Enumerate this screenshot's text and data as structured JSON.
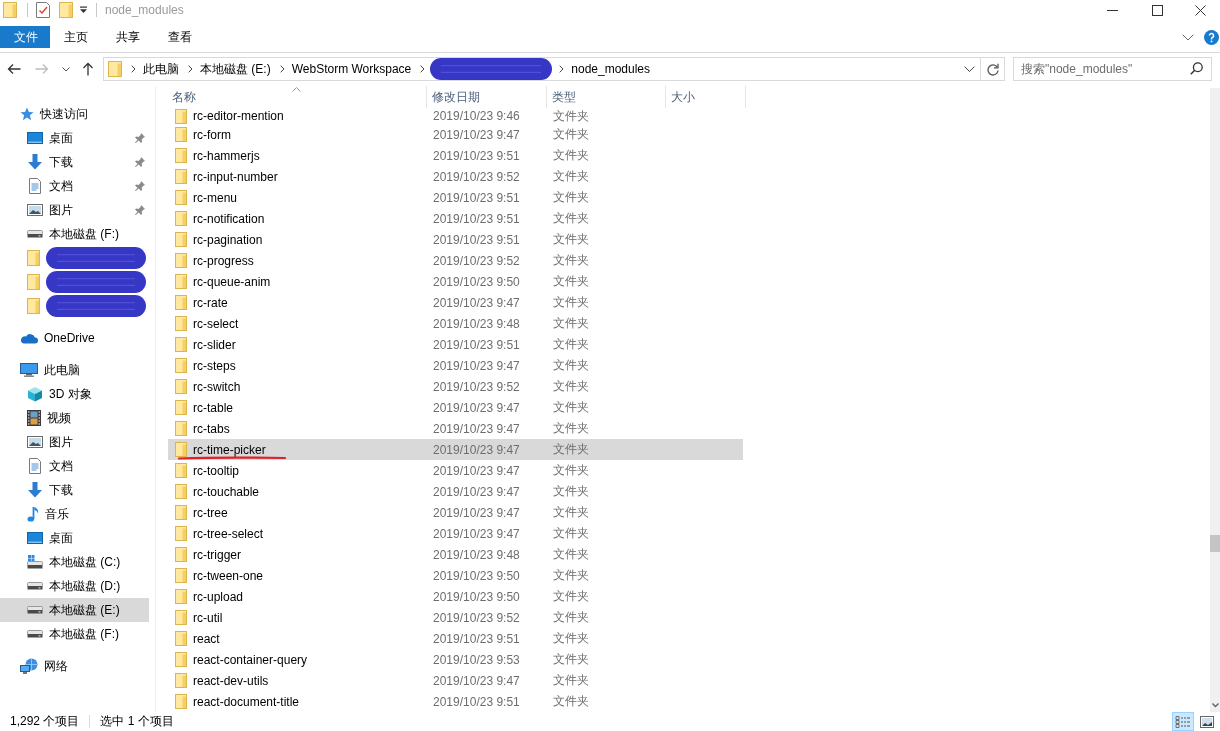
{
  "window": {
    "title": "node_modules"
  },
  "ribbon": {
    "tabs": [
      {
        "label": "文件",
        "kind": "file"
      },
      {
        "label": "主页",
        "kind": "tab"
      },
      {
        "label": "共享",
        "kind": "tab"
      },
      {
        "label": "查看",
        "kind": "tab"
      }
    ]
  },
  "navigation": {
    "back_disabled": false,
    "forward_disabled": true
  },
  "address_bar": {
    "crumbs": [
      {
        "kind": "text",
        "label": "此电脑"
      },
      {
        "kind": "text",
        "label": "本地磁盘 (E:)"
      },
      {
        "kind": "text",
        "label": "WebStorm Workspace"
      },
      {
        "kind": "redacted"
      },
      {
        "kind": "text",
        "label": "node_modules"
      }
    ]
  },
  "search": {
    "placeholder": "搜索\"node_modules\""
  },
  "sidebar": {
    "items": [
      {
        "kind": "quickaccess",
        "label": "快速访问",
        "selected": false,
        "children": [
          {
            "kind": "desktop",
            "label": "桌面",
            "selected": false,
            "pinned": true
          },
          {
            "kind": "downloads",
            "label": "下载",
            "selected": false,
            "pinned": true
          },
          {
            "kind": "documents",
            "label": "文档",
            "selected": false,
            "pinned": true
          },
          {
            "kind": "pictures",
            "label": "图片",
            "selected": false,
            "pinned": true
          },
          {
            "kind": "drive",
            "label": "本地磁盘 (F:)",
            "selected": false,
            "pinned": false
          },
          {
            "kind": "redacted",
            "selected": false,
            "pinned": false
          },
          {
            "kind": "redacted",
            "selected": false,
            "pinned": false
          },
          {
            "kind": "redacted",
            "selected": false,
            "pinned": false
          }
        ]
      },
      {
        "kind": "onedrive",
        "label": "OneDrive",
        "selected": false
      },
      {
        "kind": "computer",
        "label": "此电脑",
        "selected": false,
        "children": [
          {
            "kind": "objects",
            "label": "3D 对象",
            "selected": false
          },
          {
            "kind": "videos",
            "label": "视频",
            "selected": false
          },
          {
            "kind": "pictures",
            "label": "图片",
            "selected": false
          },
          {
            "kind": "documents",
            "label": "文档",
            "selected": false
          },
          {
            "kind": "downloads",
            "label": "下载",
            "selected": false
          },
          {
            "kind": "music",
            "label": "音乐",
            "selected": false
          },
          {
            "kind": "desktop",
            "label": "桌面",
            "selected": false
          },
          {
            "kind": "systemdrive",
            "label": "本地磁盘 (C:)",
            "selected": false
          },
          {
            "kind": "drive",
            "label": "本地磁盘 (D:)",
            "selected": false
          },
          {
            "kind": "drive",
            "label": "本地磁盘 (E:)",
            "selected": true
          },
          {
            "kind": "drive",
            "label": "本地磁盘 (F:)",
            "selected": false
          }
        ]
      },
      {
        "kind": "network",
        "label": "网络",
        "selected": false
      }
    ]
  },
  "file_list": {
    "columns": [
      {
        "label": "名称",
        "sorted": true
      },
      {
        "label": "修改日期",
        "sorted": false
      },
      {
        "label": "类型",
        "sorted": false
      },
      {
        "label": "大小",
        "sorted": false
      }
    ],
    "rows": [
      {
        "name": "rc-editor-mention",
        "modified": "2019/10/23 9:46",
        "type": "文件夹",
        "selected": false,
        "underlined": false
      },
      {
        "name": "rc-form",
        "modified": "2019/10/23 9:47",
        "type": "文件夹",
        "selected": false,
        "underlined": false
      },
      {
        "name": "rc-hammerjs",
        "modified": "2019/10/23 9:51",
        "type": "文件夹",
        "selected": false,
        "underlined": false
      },
      {
        "name": "rc-input-number",
        "modified": "2019/10/23 9:52",
        "type": "文件夹",
        "selected": false,
        "underlined": false
      },
      {
        "name": "rc-menu",
        "modified": "2019/10/23 9:51",
        "type": "文件夹",
        "selected": false,
        "underlined": false
      },
      {
        "name": "rc-notification",
        "modified": "2019/10/23 9:51",
        "type": "文件夹",
        "selected": false,
        "underlined": false
      },
      {
        "name": "rc-pagination",
        "modified": "2019/10/23 9:51",
        "type": "文件夹",
        "selected": false,
        "underlined": false
      },
      {
        "name": "rc-progress",
        "modified": "2019/10/23 9:52",
        "type": "文件夹",
        "selected": false,
        "underlined": false
      },
      {
        "name": "rc-queue-anim",
        "modified": "2019/10/23 9:50",
        "type": "文件夹",
        "selected": false,
        "underlined": false
      },
      {
        "name": "rc-rate",
        "modified": "2019/10/23 9:47",
        "type": "文件夹",
        "selected": false,
        "underlined": false
      },
      {
        "name": "rc-select",
        "modified": "2019/10/23 9:48",
        "type": "文件夹",
        "selected": false,
        "underlined": false
      },
      {
        "name": "rc-slider",
        "modified": "2019/10/23 9:51",
        "type": "文件夹",
        "selected": false,
        "underlined": false
      },
      {
        "name": "rc-steps",
        "modified": "2019/10/23 9:47",
        "type": "文件夹",
        "selected": false,
        "underlined": false
      },
      {
        "name": "rc-switch",
        "modified": "2019/10/23 9:52",
        "type": "文件夹",
        "selected": false,
        "underlined": false
      },
      {
        "name": "rc-table",
        "modified": "2019/10/23 9:47",
        "type": "文件夹",
        "selected": false,
        "underlined": false
      },
      {
        "name": "rc-tabs",
        "modified": "2019/10/23 9:47",
        "type": "文件夹",
        "selected": false,
        "underlined": false
      },
      {
        "name": "rc-time-picker",
        "modified": "2019/10/23 9:47",
        "type": "文件夹",
        "selected": true,
        "underlined": true
      },
      {
        "name": "rc-tooltip",
        "modified": "2019/10/23 9:47",
        "type": "文件夹",
        "selected": false,
        "underlined": false
      },
      {
        "name": "rc-touchable",
        "modified": "2019/10/23 9:47",
        "type": "文件夹",
        "selected": false,
        "underlined": false
      },
      {
        "name": "rc-tree",
        "modified": "2019/10/23 9:47",
        "type": "文件夹",
        "selected": false,
        "underlined": false
      },
      {
        "name": "rc-tree-select",
        "modified": "2019/10/23 9:47",
        "type": "文件夹",
        "selected": false,
        "underlined": false
      },
      {
        "name": "rc-trigger",
        "modified": "2019/10/23 9:48",
        "type": "文件夹",
        "selected": false,
        "underlined": false
      },
      {
        "name": "rc-tween-one",
        "modified": "2019/10/23 9:50",
        "type": "文件夹",
        "selected": false,
        "underlined": false
      },
      {
        "name": "rc-upload",
        "modified": "2019/10/23 9:50",
        "type": "文件夹",
        "selected": false,
        "underlined": false
      },
      {
        "name": "rc-util",
        "modified": "2019/10/23 9:52",
        "type": "文件夹",
        "selected": false,
        "underlined": false
      },
      {
        "name": "react",
        "modified": "2019/10/23 9:51",
        "type": "文件夹",
        "selected": false,
        "underlined": false
      },
      {
        "name": "react-container-query",
        "modified": "2019/10/23 9:53",
        "type": "文件夹",
        "selected": false,
        "underlined": false
      },
      {
        "name": "react-dev-utils",
        "modified": "2019/10/23 9:47",
        "type": "文件夹",
        "selected": false,
        "underlined": false
      },
      {
        "name": "react-document-title",
        "modified": "2019/10/23 9:51",
        "type": "文件夹",
        "selected": false,
        "underlined": false
      }
    ]
  },
  "status_bar": {
    "item_count": "1,292 个项目",
    "selection": "选中 1 个项目",
    "views": [
      {
        "kind": "details",
        "selected": true
      },
      {
        "kind": "icons",
        "selected": false
      }
    ]
  }
}
